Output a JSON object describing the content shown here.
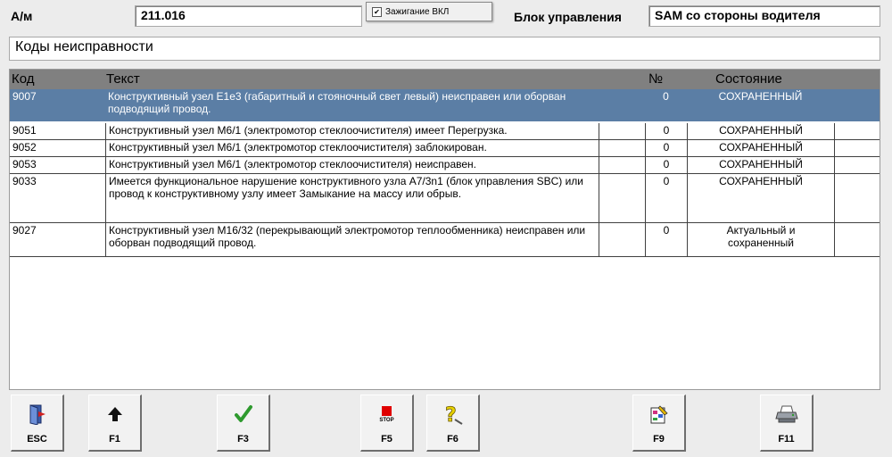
{
  "header": {
    "vehicle_label": "А/м",
    "vehicle_value": "211.016",
    "ignition_text": "Зажигание ВКЛ",
    "ignition_checked_glyph": "☑",
    "unit_label": "Блок управления",
    "unit_value": "SAM со стороны водителя"
  },
  "section_title": "Коды неисправности",
  "table": {
    "columns": {
      "code": "Код",
      "text": "Текст",
      "num": "№",
      "state": "Состояние"
    },
    "rows": [
      {
        "code": "9007",
        "text": "Конструктивный узел E1e3 (габаритный и стояночный свет левый) неисправен или оборван подводящий провод.",
        "num": "0",
        "state": "СОХРАНЕННЫЙ",
        "selected": true
      },
      {
        "code": "9051",
        "text": "Конструктивный узел M6/1 (электромотор стеклоочистителя) имеет Перегрузка.",
        "num": "0",
        "state": "СОХРАНЕННЫЙ"
      },
      {
        "code": "9052",
        "text": "Конструктивный узел M6/1 (электромотор стеклоочистителя) заблокирован.",
        "num": "0",
        "state": "СОХРАНЕННЫЙ"
      },
      {
        "code": "9053",
        "text": "Конструктивный узел M6/1 (электромотор стеклоочистителя) неисправен.",
        "num": "0",
        "state": "СОХРАНЕННЫЙ"
      },
      {
        "code": "9033",
        "text": "Имеется функциональное нарушение конструктивного узла A7/3n1 (блок управления SBC) или провод к конструктивному узлу имеет Замыкание на массу или обрыв.",
        "num": "0",
        "state": "СОХРАНЕННЫЙ"
      },
      {
        "code": "9027",
        "text": "Конструктивный узел M16/32 (перекрывающий электромотор теплообменника) неисправен или оборван подводящий провод.",
        "num": "0",
        "state": "Актуальный и сохраненный"
      }
    ]
  },
  "toolbar": {
    "esc": {
      "label": "ESC",
      "icon": "door-exit-icon"
    },
    "f1": {
      "label": "F1",
      "icon": "arrow-up-icon"
    },
    "f3": {
      "label": "F3",
      "icon": "checkmark-icon"
    },
    "f5": {
      "label": "F5",
      "icon": "stop-icon",
      "icon_text": "STOP"
    },
    "f6": {
      "label": "F6",
      "icon": "help-icon"
    },
    "f9": {
      "label": "F9",
      "icon": "edit-document-icon"
    },
    "f11": {
      "label": "F11",
      "icon": "printer-icon"
    }
  },
  "colors": {
    "selected_row": "#5b7ea5",
    "header_row": "#808080",
    "stop_red": "#e00000",
    "check_green": "#2e9a2e",
    "help_yellow": "#e8d200"
  }
}
